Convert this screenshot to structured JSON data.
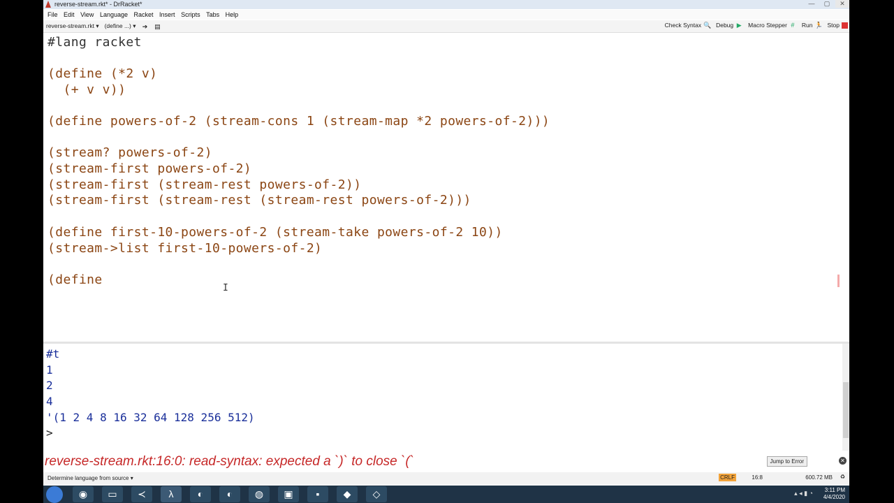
{
  "window": {
    "title": "reverse-stream.rkt* - DrRacket*"
  },
  "menu": [
    "File",
    "Edit",
    "View",
    "Language",
    "Racket",
    "Insert",
    "Scripts",
    "Tabs",
    "Help"
  ],
  "toolbar": {
    "file_dropdown": "reverse-stream.rkt ▾",
    "define_dropdown": "(define ...) ▾",
    "check_syntax": "Check Syntax",
    "debug": "Debug",
    "macro_stepper": "Macro Stepper",
    "run": "Run",
    "stop": "Stop"
  },
  "editor": {
    "lines": [
      "#lang racket",
      "(define (*2 v)",
      "  (+ v v))",
      "(define powers-of-2 (stream-cons 1 (stream-map *2 powers-of-2)))",
      "(stream? powers-of-2)",
      "(stream-first powers-of-2)",
      "(stream-first (stream-rest powers-of-2))",
      "(stream-first (stream-rest (stream-rest powers-of-2)))",
      "(define first-10-powers-of-2 (stream-take powers-of-2 10))",
      "(stream->list first-10-powers-of-2)",
      "(define"
    ]
  },
  "interactions": {
    "lines": [
      "#t",
      "1",
      "2",
      "4",
      "'(1 2 4 8 16 32 64 128 256 512)",
      ">"
    ]
  },
  "error": {
    "message": "reverse-stream.rkt:16:0: read-syntax: expected a `)` to close `(`",
    "jump_label": "Jump to Error"
  },
  "status": {
    "language": "Determine language from source ▾",
    "line_ending": "CRLF",
    "position": "16:8",
    "memory": "600.72 MB"
  },
  "taskbar": {
    "time": "3:11 PM",
    "date": "4/4/2020"
  }
}
